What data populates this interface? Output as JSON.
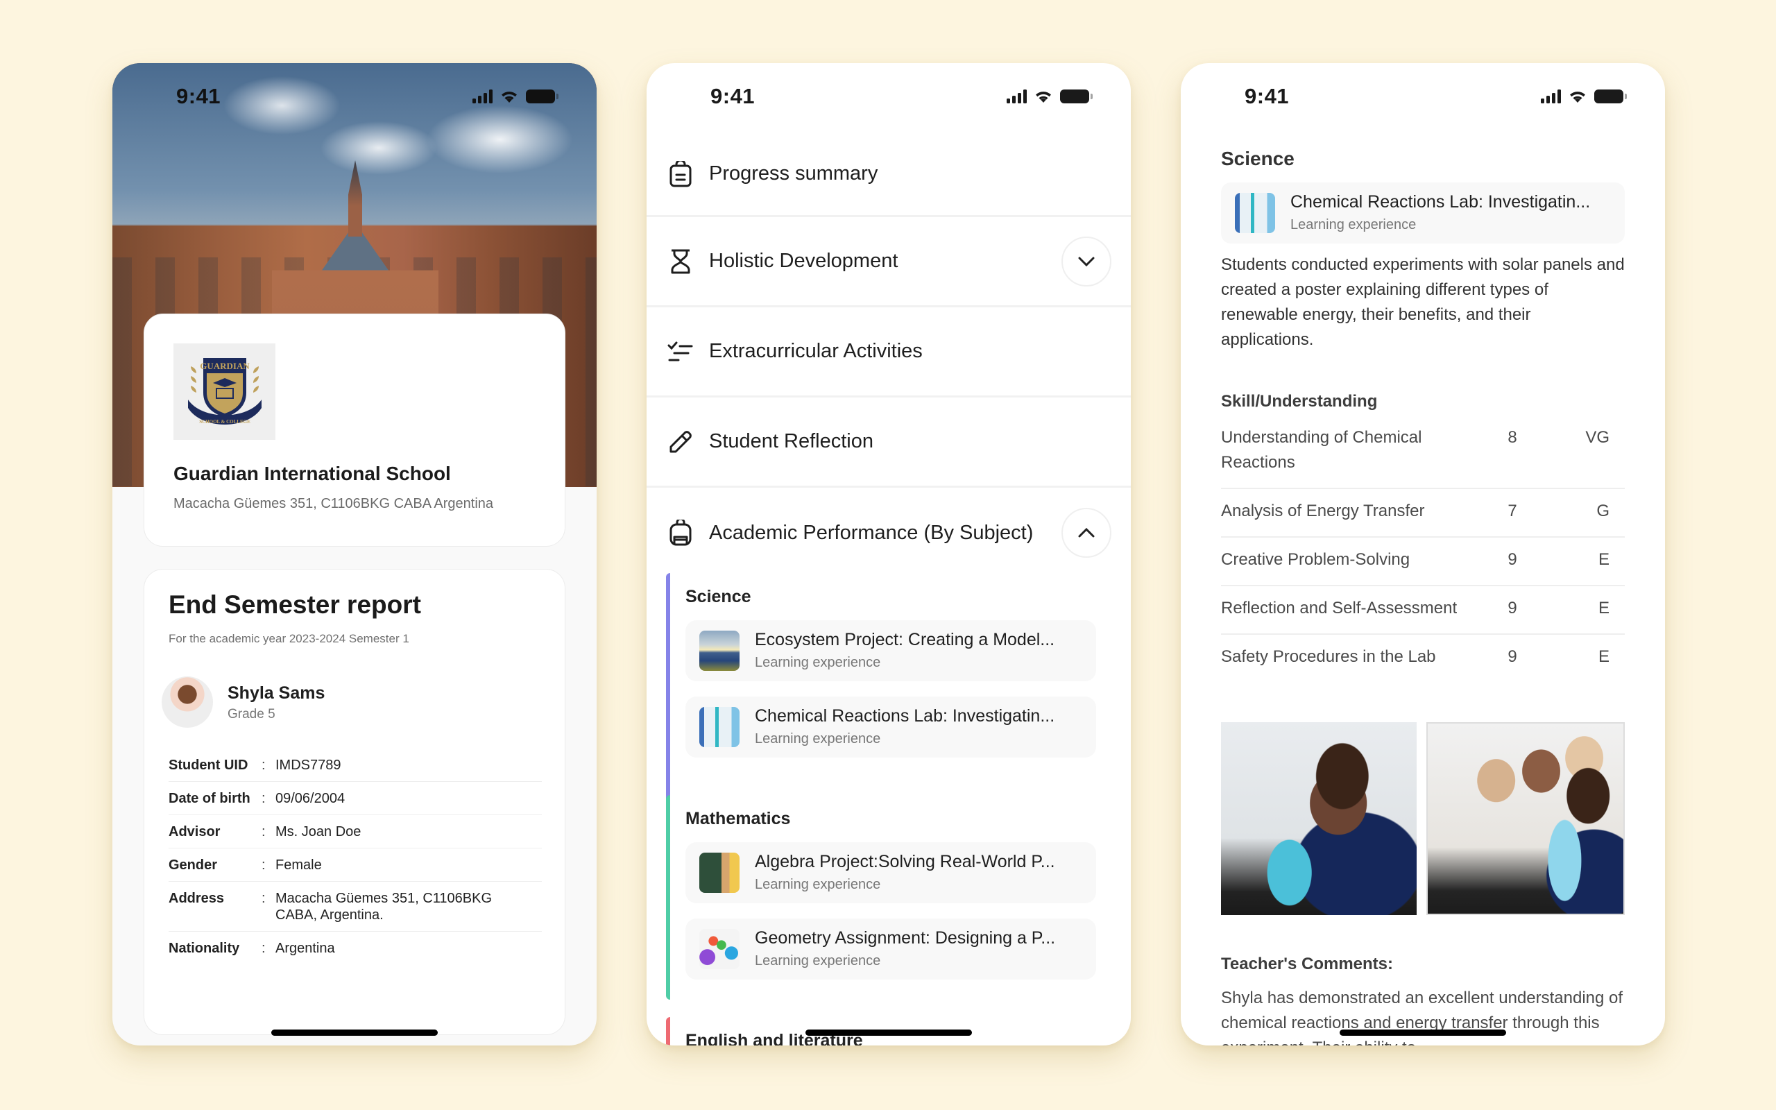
{
  "status_bar": {
    "time": "9:41"
  },
  "phone1": {
    "school": {
      "logo_alt": "Guardian School & College crest",
      "logo_text_top": "GUARDIAN",
      "logo_text_bottom": "SCHOOL & COLLEGE",
      "name": "Guardian International School",
      "address": "Macacha Güemes 351, C1106BKG CABA Argentina"
    },
    "report": {
      "title": "End Semester report",
      "subtitle": "For the academic year 2023-2024  Semester 1",
      "student": {
        "name": "Shyla Sams",
        "grade": "Grade 5"
      },
      "fields": [
        {
          "label": "Student UID",
          "sep": ":",
          "value": "IMDS7789"
        },
        {
          "label": "Date of birth",
          "sep": ":",
          "value": "09/06/2004"
        },
        {
          "label": "Advisor",
          "sep": ":",
          "value": "Ms. Joan Doe"
        },
        {
          "label": "Gender",
          "sep": ":",
          "value": "Female"
        },
        {
          "label": "Address",
          "sep": ":",
          "value": "Macacha Güemes 351, C1106BKG CABA, Argentina."
        },
        {
          "label": "Nationality",
          "sep": ":",
          "value": "Argentina"
        }
      ]
    }
  },
  "phone2": {
    "menu": [
      {
        "label": "Progress summary",
        "icon": "clipboard-icon"
      },
      {
        "label": "Holistic Development",
        "icon": "hourglass-icon",
        "toggle": "chevron-down-icon"
      },
      {
        "label": "Extracurricular Activities",
        "icon": "checklist-icon"
      },
      {
        "label": "Student Reflection",
        "icon": "pencil-icon"
      },
      {
        "label": "Academic Performance (By Subject)",
        "icon": "backpack-icon",
        "toggle": "chevron-up-icon"
      }
    ],
    "subjects": [
      {
        "name": "Science",
        "color": "#8583E8",
        "items": [
          {
            "title": "Ecosystem Project: Creating a Model...",
            "type": "Learning experience"
          },
          {
            "title": "Chemical Reactions Lab: Investigatin...",
            "type": "Learning experience"
          }
        ]
      },
      {
        "name": "Mathematics",
        "color": "#4FCDA6",
        "items": [
          {
            "title": "Algebra Project:Solving Real-World P...",
            "type": "Learning experience"
          },
          {
            "title": "Geometry Assignment: Designing a P...",
            "type": "Learning experience"
          }
        ]
      },
      {
        "name": "English and literature",
        "color": "#EE6A72",
        "items": []
      }
    ]
  },
  "phone3": {
    "section_title": "Science",
    "experience": {
      "title": "Chemical Reactions Lab: Investigatin...",
      "type": "Learning experience"
    },
    "description": "Students conducted experiments with solar panels and created a poster explaining different types of renewable energy, their benefits, and their applications.",
    "skills_heading": "Skill/Understanding",
    "skills": [
      {
        "name": "Understanding of Chemical Reactions",
        "score": "8",
        "grade": "VG"
      },
      {
        "name": "Analysis of Energy Transfer",
        "score": "7",
        "grade": "G"
      },
      {
        "name": "Creative Problem-Solving",
        "score": "9",
        "grade": "E"
      },
      {
        "name": "Reflection and Self-Assessment",
        "score": "9",
        "grade": "E"
      },
      {
        "name": "Safety Procedures in the Lab",
        "score": "9",
        "grade": "E"
      }
    ],
    "photos": [
      {
        "alt": "Student pouring blue liquid into beaker"
      },
      {
        "alt": "Students reacting to foaming experiment"
      }
    ],
    "comments_heading": "Teacher's Comments:",
    "comments": "Shyla has demonstrated an excellent understanding of chemical reactions and energy transfer through this experiment. Their ability to"
  }
}
